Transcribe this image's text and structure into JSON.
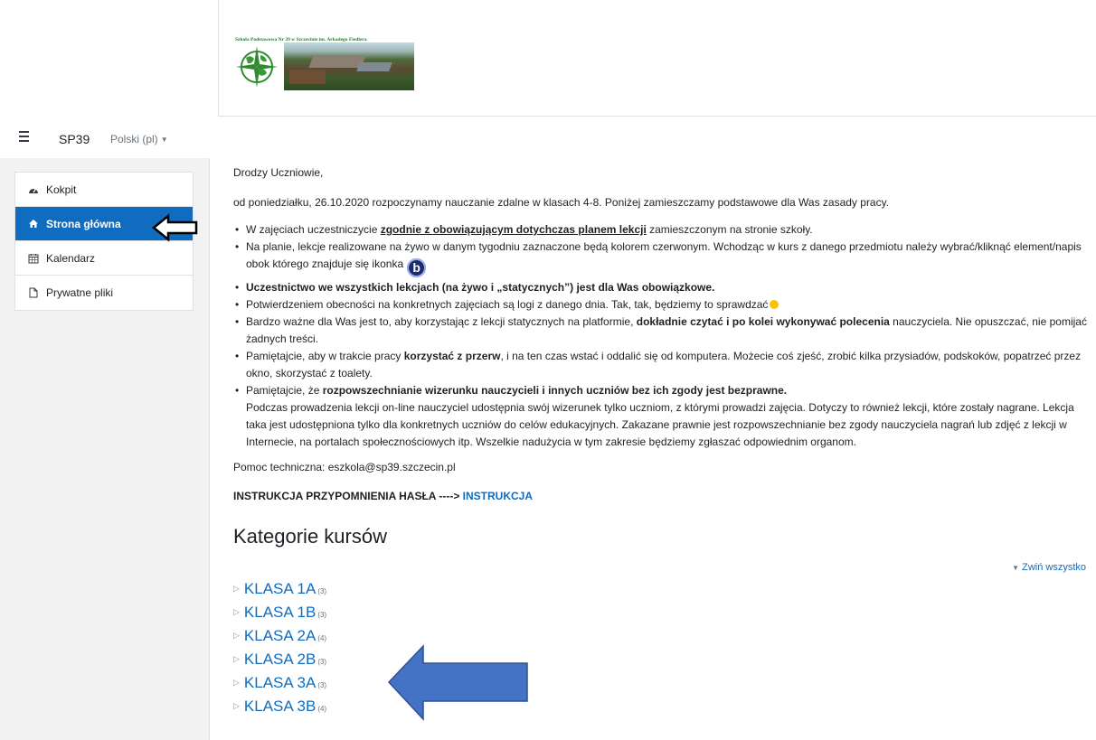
{
  "header": {
    "school_name": "Szkoła Podstawowa Nr 39 w Szczecinie im. Arkadego Fiedlera"
  },
  "navbar": {
    "site_name": "SP39",
    "language": "Polski (pl)"
  },
  "sidebar": {
    "items": [
      {
        "label": "Kokpit",
        "icon": "dashboard-icon",
        "active": false
      },
      {
        "label": "Strona główna",
        "icon": "home-icon",
        "active": true
      },
      {
        "label": "Kalendarz",
        "icon": "calendar-icon",
        "active": false
      },
      {
        "label": "Prywatne pliki",
        "icon": "file-icon",
        "active": false
      }
    ]
  },
  "main": {
    "greeting": "Drodzy Uczniowie,",
    "intro": "od poniedziałku, 26.10.2020 rozpoczynamy nauczanie zdalne w klasach 4-8. Poniżej zamieszczamy podstawowe dla Was zasady pracy.",
    "rule1_pre": "W zajęciach uczestniczycie ",
    "rule1_bold": "zgodnie z obowiązującym dotychczas planem lekcji",
    "rule1_post": " zamieszczonym na stronie szkoły.",
    "rule2": "Na planie, lekcje realizowane na żywo w danym tygodniu zaznaczone będą kolorem czerwonym. Wchodząc w kurs z danego przedmiotu należy wybrać/kliknąć element/napis obok którego znajduje się ikonka",
    "rule2_icon": "b",
    "rule3": "Uczestnictwo we wszystkich lekcjach (na żywo i „statycznych”) jest dla Was obowiązkowe.",
    "rule4": "Potwierdzeniem obecności na konkretnych zajęciach są logi z danego dnia. Tak, tak, będziemy to sprawdzać",
    "rule5_pre": "Bardzo ważne dla Was jest to, aby korzystając z lekcji statycznych na platformie, ",
    "rule5_bold": "dokładnie czytać i po kolei wykonywać polecenia",
    "rule5_post": " nauczyciela. Nie opuszczać, nie pomijać żadnych treści.",
    "rule6_pre": "Pamiętajcie, aby w trakcie pracy ",
    "rule6_bold": "korzystać z przerw",
    "rule6_post": ", i na ten czas wstać i oddalić się od komputera. Możecie coś zjeść, zrobić kilka przysiadów, podskoków, popatrzeć przez okno, skorzystać z toalety.",
    "rule7_pre": "Pamiętajcie, że ",
    "rule7_bold": "rozpowszechnianie wizerunku nauczycieli i innych uczniów bez ich zgody jest bezprawne.",
    "rule7_detail": "Podczas prowadzenia lekcji on-line nauczyciel udostępnia swój wizerunek tylko uczniom, z którymi prowadzi zajęcia. Dotyczy to również lekcji, które zostały nagrane. Lekcja taka jest udostępniona tylko dla konkretnych uczniów do celów edukacyjnych. Zakazane prawnie jest rozpowszechnianie bez zgody nauczyciela nagrań lub zdjęć z lekcji w Internecie, na portalach społecznościowych itp. Wszelkie nadużycia w tym zakresie będziemy zgłaszać odpowiednim organom.",
    "help": "Pomoc techniczna: eszkola@sp39.szczecin.pl",
    "password_label": "INSTRUKCJA PRZYPOMNIENIA HASŁA ----> ",
    "password_link": "INSTRUKCJA",
    "categories_heading": "Kategorie kursów",
    "collapse_all": "Zwiń wszystko",
    "categories": [
      {
        "name": "KLASA 1A",
        "count": "(3)"
      },
      {
        "name": "KLASA 1B",
        "count": "(3)"
      },
      {
        "name": "KLASA 2A",
        "count": "(4)"
      },
      {
        "name": "KLASA 2B",
        "count": "(3)"
      },
      {
        "name": "KLASA 3A",
        "count": "(3)"
      },
      {
        "name": "KLASA 3B",
        "count": "(4)"
      }
    ]
  },
  "colors": {
    "accent": "#0f6cbf",
    "annotation_arrow": "#4472c4"
  }
}
